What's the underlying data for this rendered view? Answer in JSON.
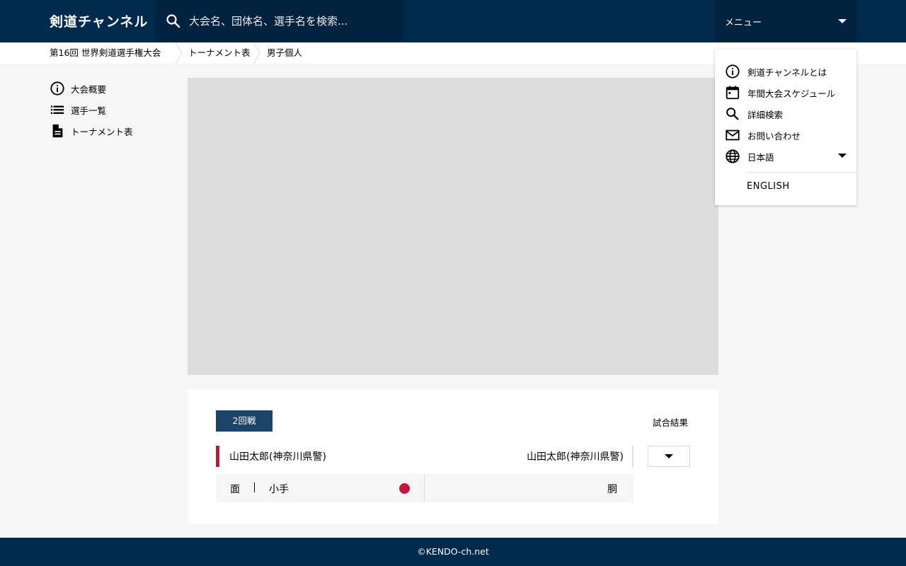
{
  "header": {
    "logo": "剣道チャンネル",
    "search_placeholder": "大会名、団体名、選手名を検索...",
    "menu_label": "メニュー"
  },
  "breadcrumb": [
    "第16回 世界剣道選手権大会",
    "トーナメント表",
    "男子個人"
  ],
  "sidebar": {
    "items": [
      {
        "label": "大会概要",
        "icon": "info-icon"
      },
      {
        "label": "選手一覧",
        "icon": "list-icon"
      },
      {
        "label": "トーナメント表",
        "icon": "document-icon"
      }
    ]
  },
  "match": {
    "round": "2回戦",
    "result_label": "試合結果",
    "player_left": "山田太郎(神奈川県警)",
    "player_right": "山田太郎(神奈川県警)",
    "score_left": [
      "面",
      "小手"
    ],
    "score_right": "胴",
    "accent_color": "#c8143c"
  },
  "menu": {
    "items": [
      {
        "label": "剣道チャンネルとは",
        "icon": "info-icon"
      },
      {
        "label": "年間大会スケジュール",
        "icon": "calendar-icon"
      },
      {
        "label": "詳細検索",
        "icon": "search-icon"
      },
      {
        "label": "お問い合わせ",
        "icon": "mail-icon"
      },
      {
        "label": "日本語",
        "icon": "globe-icon"
      }
    ],
    "language_option": "ENGLISH"
  },
  "footer": {
    "copyright": "©KENDO-ch.net"
  },
  "colors": {
    "navy": "#002a4c",
    "badge": "#1c4469",
    "red": "#c8143c"
  }
}
